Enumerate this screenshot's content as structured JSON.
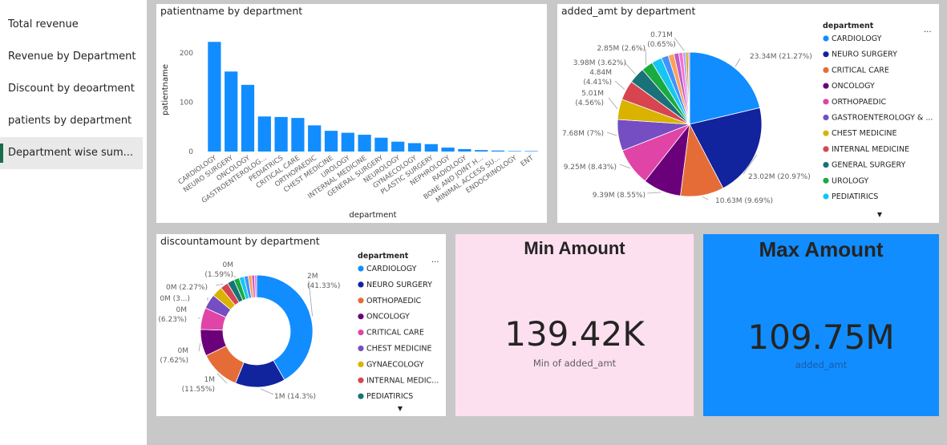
{
  "sidebar": {
    "items": [
      {
        "label": "Total revenue",
        "active": false
      },
      {
        "label": "Revenue by Department",
        "active": false
      },
      {
        "label": "Discount by deoartment",
        "active": false
      },
      {
        "label": "patients by department",
        "active": false
      },
      {
        "label": "Department wise sum...",
        "active": true
      }
    ]
  },
  "colors": {
    "primary_bar": "#118dff",
    "min_card_bg": "#fde0f0",
    "max_card_bg": "#118dff",
    "palette": [
      "#118dff",
      "#12239e",
      "#e66c37",
      "#6b007b",
      "#e044a7",
      "#744ec2",
      "#d9b300",
      "#d64550",
      "#197278",
      "#1aab40",
      "#15c6f4",
      "#4092ff",
      "#ffa058",
      "#be5dc9",
      "#f472d0",
      "#b5a1ff",
      "#c4a200",
      "#ff8080",
      "#00dbbc",
      "#5bd667"
    ]
  },
  "icons": {
    "legend_more": "more-options-icon",
    "legend_scroll": "scroll-down-icon"
  },
  "chart_data": [
    {
      "type": "bar",
      "title": "patientname by department",
      "xlabel": "department",
      "ylabel": "patientname",
      "ylim": [
        0,
        250
      ],
      "yticks": [
        0,
        100,
        200
      ],
      "categories": [
        "CARDIOLOGY",
        "NEURO SURGERY",
        "ONCOLOGY",
        "GASTROENTEROLOG...",
        "PEDIATRICS",
        "CRITICAL CARE",
        "ORTHOPAEDIC",
        "CHEST MEDICINE",
        "UROLOGY",
        "INTERNAL MEDICINE",
        "GENERAL SURGERY",
        "NEUROLOGY",
        "GYNAECOLOGY",
        "PLASTIC SURGERY",
        "NEPHROLOGY",
        "RADIOLOGY",
        "BONE AND JOINT H...",
        "MINIMAL ACCESS SU...",
        "ENDOCRINOLOGY",
        "ENT"
      ],
      "values": [
        222,
        162,
        135,
        71,
        70,
        68,
        53,
        42,
        38,
        34,
        28,
        20,
        17,
        15,
        8,
        5,
        3,
        2,
        1,
        1
      ]
    },
    {
      "type": "pie",
      "title": "added_amt by department",
      "legend_title": "department",
      "legend": [
        "CARDIOLOGY",
        "NEURO SURGERY",
        "CRITICAL CARE",
        "ONCOLOGY",
        "ORTHOPAEDIC",
        "GASTROENTEROLOGY & ...",
        "CHEST MEDICINE",
        "INTERNAL MEDICINE",
        "GENERAL SURGERY",
        "UROLOGY",
        "PEDIATIRICS"
      ],
      "slices": [
        {
          "label": "CARDIOLOGY",
          "value": 21.27,
          "data_label": "23.34M (21.27%)"
        },
        {
          "label": "NEURO SURGERY",
          "value": 20.97,
          "data_label": "23.02M (20.97%)"
        },
        {
          "label": "CRITICAL CARE",
          "value": 9.69,
          "data_label": "10.63M (9.69%)"
        },
        {
          "label": "ONCOLOGY",
          "value": 8.55,
          "data_label": "9.39M (8.55%)"
        },
        {
          "label": "ORTHOPAEDIC",
          "value": 8.43,
          "data_label": "9.25M (8.43%)"
        },
        {
          "label": "GASTROENTEROLOGY & ...",
          "value": 7.0,
          "data_label": "7.68M (7%)"
        },
        {
          "label": "CHEST MEDICINE",
          "value": 4.56,
          "data_label": "5.01M (4.56%)"
        },
        {
          "label": "INTERNAL MEDICINE",
          "value": 4.41,
          "data_label": "4.84M (4.41%)"
        },
        {
          "label": "GENERAL SURGERY",
          "value": 3.62,
          "data_label": "3.98M (3.62%)"
        },
        {
          "label": "UROLOGY",
          "value": 2.6,
          "data_label": "2.85M (2.6%)"
        },
        {
          "label": "PEDIATIRICS",
          "value": 2.3,
          "data_label": ""
        },
        {
          "label": "",
          "value": 1.6,
          "data_label": ""
        },
        {
          "label": "",
          "value": 1.3,
          "data_label": ""
        },
        {
          "label": "",
          "value": 1.1,
          "data_label": ""
        },
        {
          "label": "",
          "value": 0.9,
          "data_label": ""
        },
        {
          "label": "",
          "value": 0.65,
          "data_label": "0.71M (0.65%)"
        },
        {
          "label": "",
          "value": 0.5,
          "data_label": ""
        },
        {
          "label": "",
          "value": 0.35,
          "data_label": ""
        }
      ]
    },
    {
      "type": "donut",
      "title": "discountamount by department",
      "legend_title": "department",
      "legend": [
        "CARDIOLOGY",
        "NEURO SURGERY",
        "ORTHOPAEDIC",
        "ONCOLOGY",
        "CRITICAL CARE",
        "CHEST MEDICINE",
        "GYNAECOLOGY",
        "INTERNAL MEDIC...",
        "PEDIATIRICS"
      ],
      "slices": [
        {
          "label": "CARDIOLOGY",
          "value": 41.33,
          "data_label": "2M (41.33%)"
        },
        {
          "label": "NEURO SURGERY",
          "value": 14.3,
          "data_label": "1M (14.3%)"
        },
        {
          "label": "ORTHOPAEDIC",
          "value": 11.55,
          "data_label": "1M (11.55%)"
        },
        {
          "label": "ONCOLOGY",
          "value": 7.62,
          "data_label": "0M (7.62%)"
        },
        {
          "label": "CRITICAL CARE",
          "value": 6.23,
          "data_label": "0M (6.23%)"
        },
        {
          "label": "CHEST MEDICINE",
          "value": 4.2,
          "data_label": "0M (3...)"
        },
        {
          "label": "GYNAECOLOGY",
          "value": 3.0,
          "data_label": ""
        },
        {
          "label": "INTERNAL MEDIC...",
          "value": 2.27,
          "data_label": "0M (2.27%)"
        },
        {
          "label": "PEDIATIRICS",
          "value": 2.0,
          "data_label": ""
        },
        {
          "label": "",
          "value": 1.59,
          "data_label": "0M (1.59%)"
        },
        {
          "label": "",
          "value": 1.4,
          "data_label": ""
        },
        {
          "label": "",
          "value": 1.2,
          "data_label": ""
        },
        {
          "label": "",
          "value": 1.0,
          "data_label": ""
        },
        {
          "label": "",
          "value": 0.8,
          "data_label": ""
        },
        {
          "label": "",
          "value": 0.6,
          "data_label": ""
        }
      ]
    }
  ],
  "kpis": {
    "min": {
      "title": "Min Amount",
      "value": "139.42K",
      "label": "Min of added_amt"
    },
    "max": {
      "title": "Max Amount",
      "value": "109.75M",
      "label": "added_amt"
    }
  }
}
